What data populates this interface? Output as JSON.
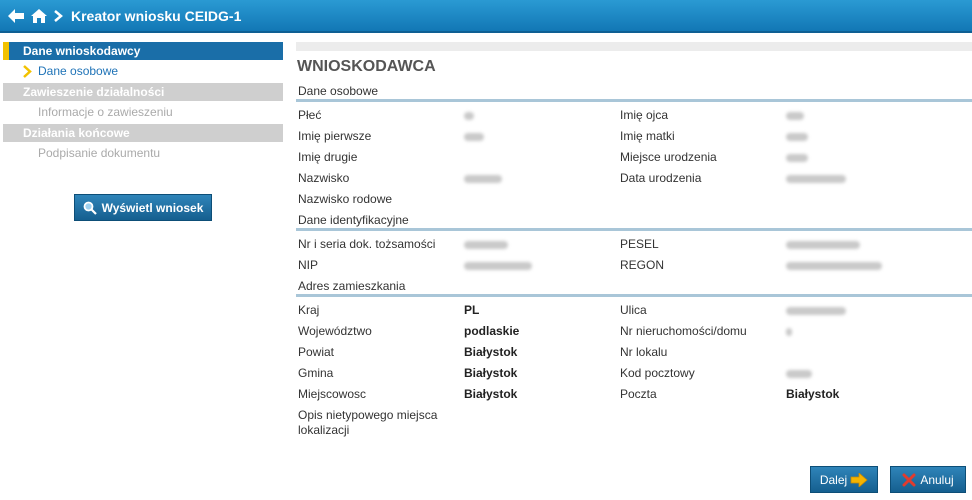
{
  "header": {
    "title": "Kreator wniosku CEIDG-1"
  },
  "sidebar": {
    "sections": [
      {
        "label": "Dane wnioskodawcy",
        "items": [
          {
            "label": "Dane osobowe"
          }
        ]
      },
      {
        "label": "Zawieszenie działalności",
        "items": [
          {
            "label": "Informacje o zawieszeniu"
          }
        ]
      },
      {
        "label": "Działania końcowe",
        "items": [
          {
            "label": "Podpisanie dokumentu"
          }
        ]
      }
    ],
    "preview_button": "Wyświetl wniosek"
  },
  "main": {
    "title": "WNIOSKODAWCA",
    "groups": [
      {
        "title": "Dane osobowe",
        "rows": [
          {
            "label1": "Płeć",
            "label2": "Imię ojca"
          },
          {
            "label1": "Imię pierwsze",
            "label2": "Imię matki"
          },
          {
            "label1": "Imię drugie",
            "label2": "Miejsce urodzenia"
          },
          {
            "label1": "Nazwisko",
            "label2": "Data urodzenia"
          },
          {
            "label1": "Nazwisko rodowe",
            "label2": ""
          }
        ]
      },
      {
        "title": "Dane identyfikacyjne",
        "rows": [
          {
            "label1": "Nr i seria dok. tożsamości",
            "label2": "PESEL"
          },
          {
            "label1": "NIP",
            "label2": "REGON"
          }
        ]
      },
      {
        "title": "Adres zamieszkania",
        "rows": [
          {
            "label1": "Kraj",
            "value1": "PL",
            "label2": "Ulica"
          },
          {
            "label1": "Województwo",
            "value1": "podlaskie",
            "label2": "Nr nieruchomości/domu"
          },
          {
            "label1": "Powiat",
            "value1": "Białystok",
            "label2": "Nr lokalu"
          },
          {
            "label1": "Gmina",
            "value1": "Białystok",
            "label2": "Kod pocztowy"
          },
          {
            "label1": "Miejscowosc",
            "value1": "Białystok",
            "label2": "Poczta",
            "value2": "Białystok"
          },
          {
            "label1": "Opis nietypowego miejsca lokalizacji"
          }
        ]
      }
    ]
  },
  "actions": {
    "next": "Dalej",
    "cancel": "Anuluj"
  },
  "colors": {
    "accent": "#1a6ea8",
    "active_marker": "#f2c200",
    "header": "#1277b5"
  }
}
